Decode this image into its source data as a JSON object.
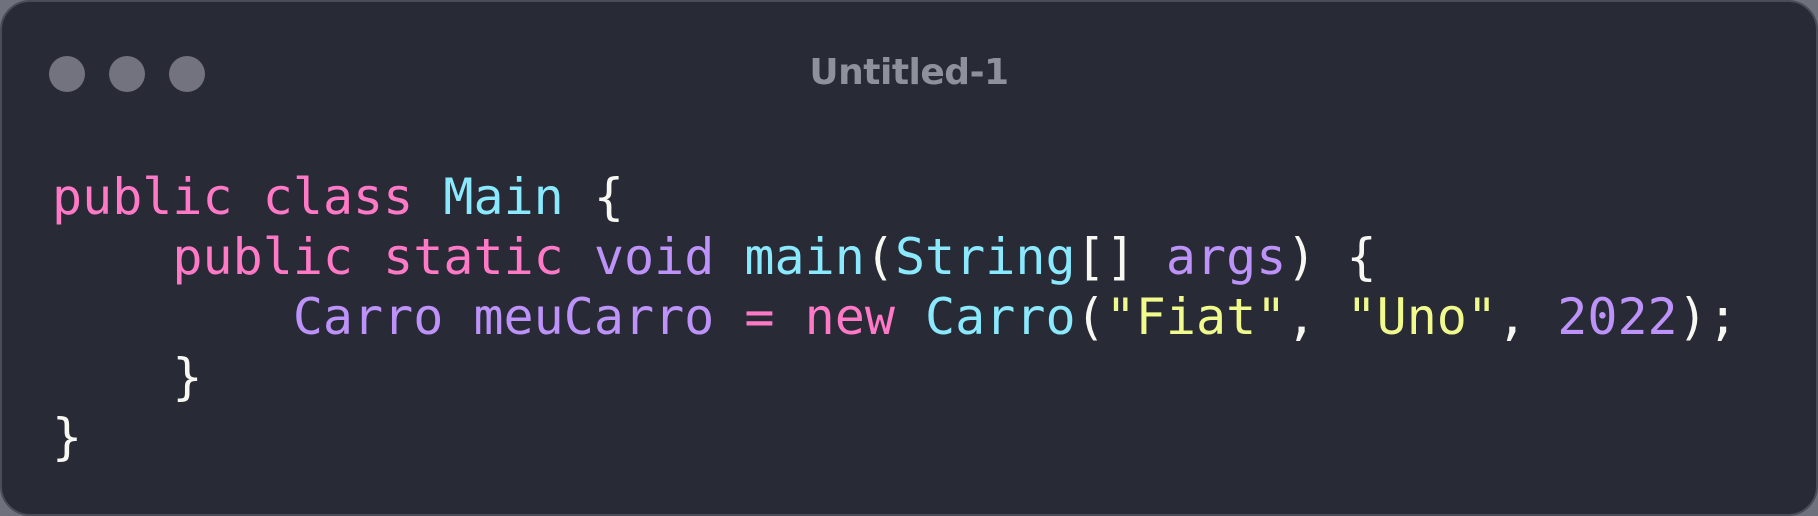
{
  "window": {
    "title": "Untitled-1",
    "controls": [
      "close",
      "minimize",
      "maximize"
    ]
  },
  "colors": {
    "background": "#282a36",
    "keyword": "#ff79c6",
    "type": "#8be9fd",
    "variable": "#bd93f9",
    "string": "#f1fa8c",
    "number": "#bd93f9",
    "plain": "#f8f8f2"
  },
  "code": {
    "lines": [
      [
        {
          "t": "public",
          "k": "kw"
        },
        {
          "t": " ",
          "k": "pl"
        },
        {
          "t": "class",
          "k": "kw"
        },
        {
          "t": " ",
          "k": "pl"
        },
        {
          "t": "Main",
          "k": "typ"
        },
        {
          "t": " {",
          "k": "pl"
        }
      ],
      [
        {
          "t": "    ",
          "k": "pl"
        },
        {
          "t": "public",
          "k": "kw"
        },
        {
          "t": " ",
          "k": "pl"
        },
        {
          "t": "static",
          "k": "kw"
        },
        {
          "t": " ",
          "k": "pl"
        },
        {
          "t": "void",
          "k": "var"
        },
        {
          "t": " ",
          "k": "pl"
        },
        {
          "t": "main",
          "k": "fn"
        },
        {
          "t": "(",
          "k": "pl"
        },
        {
          "t": "String",
          "k": "typ"
        },
        {
          "t": "[] ",
          "k": "pl"
        },
        {
          "t": "args",
          "k": "var"
        },
        {
          "t": ") {",
          "k": "pl"
        }
      ],
      [
        {
          "t": "        ",
          "k": "pl"
        },
        {
          "t": "Carro",
          "k": "var"
        },
        {
          "t": " ",
          "k": "pl"
        },
        {
          "t": "meuCarro",
          "k": "var"
        },
        {
          "t": " ",
          "k": "pl"
        },
        {
          "t": "=",
          "k": "kw"
        },
        {
          "t": " ",
          "k": "pl"
        },
        {
          "t": "new",
          "k": "kw"
        },
        {
          "t": " ",
          "k": "pl"
        },
        {
          "t": "Carro",
          "k": "typ"
        },
        {
          "t": "(",
          "k": "pl"
        },
        {
          "t": "\"Fiat\"",
          "k": "str"
        },
        {
          "t": ", ",
          "k": "pl"
        },
        {
          "t": "\"Uno\"",
          "k": "str"
        },
        {
          "t": ", ",
          "k": "pl"
        },
        {
          "t": "2022",
          "k": "num"
        },
        {
          "t": ");",
          "k": "pl"
        }
      ],
      [
        {
          "t": "    }",
          "k": "pl"
        }
      ],
      [
        {
          "t": "}",
          "k": "pl"
        }
      ]
    ]
  }
}
